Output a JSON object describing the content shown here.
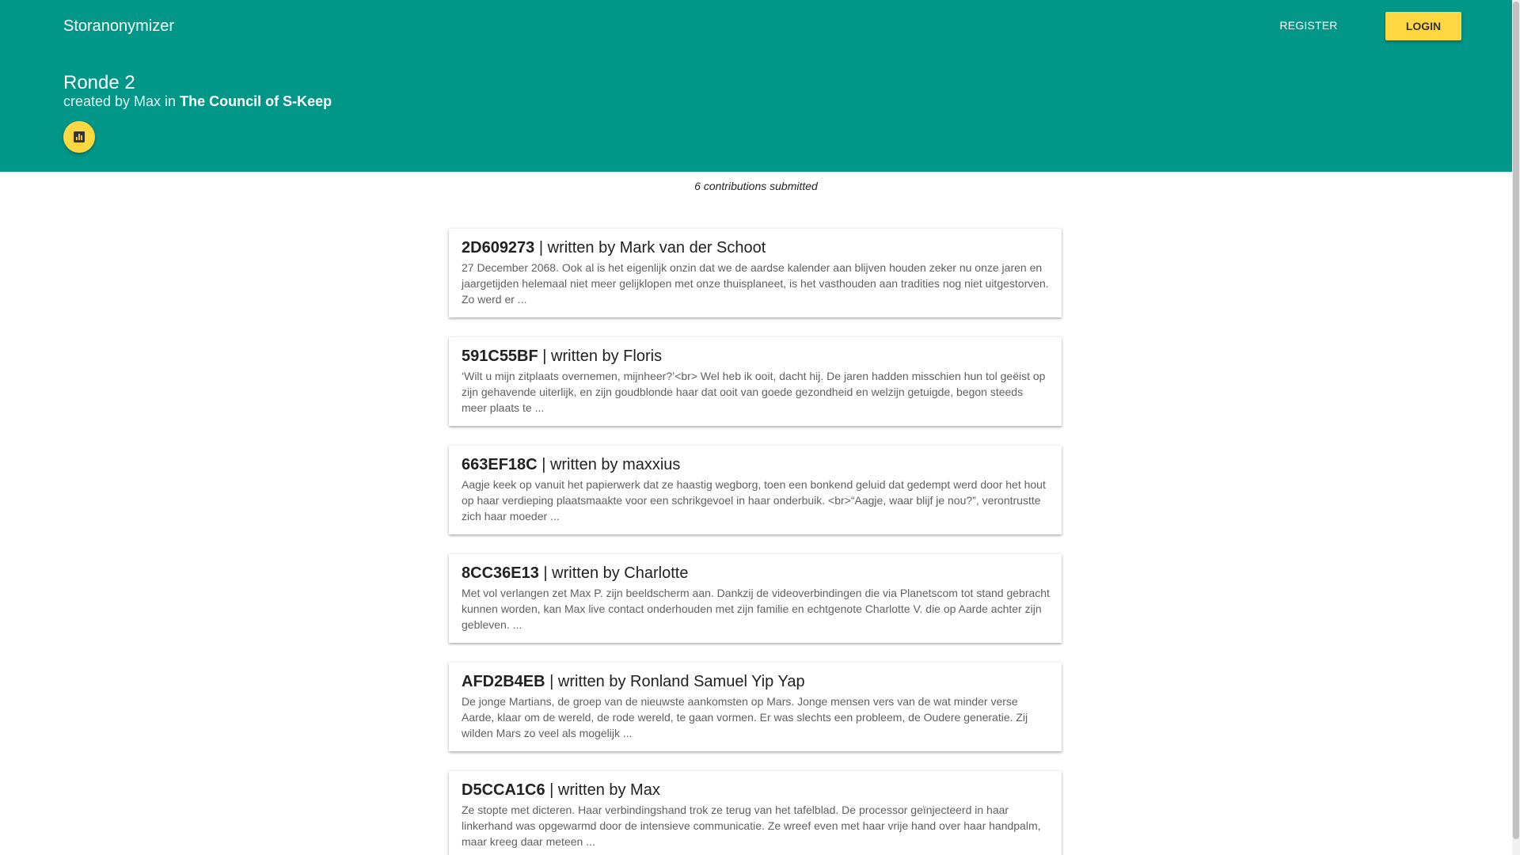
{
  "app": {
    "brand": "Storanonymizer",
    "register_label": "REGISTER",
    "login_label": "LOGIN"
  },
  "round": {
    "title": "Ronde 2",
    "created_prefix": "created by Max in",
    "group": "The Council of S-Keep",
    "stats_icon": "bar-chart-icon"
  },
  "contributions_count": "6 contributions submitted",
  "contributions": [
    {
      "id": "2D609273",
      "byline": "| written by Mark van der Schoot",
      "excerpt": "27 December 2068. Ook al is het eigenlijk onzin dat we de aardse kalender aan blijven houden zeker nu onze jaren en jaargetijden helemaal niet meer gelijklopen met onze thuisplaneet, is het vasthouden aan tradities nog niet uitgestorven. Zo werd er ..."
    },
    {
      "id": "591C55BF",
      "byline": "| written by Floris",
      "excerpt": "‘Wilt u mijn zitplaats overnemen, mijnheer?’<br> Wel heb ik ooit, dacht hij. De jaren hadden misschien hun tol geëist op zijn gehavende uiterlijk, en zijn goudblonde haar dat ooit van goede gezondheid en welzijn getuigde, begon steeds meer plaats te ..."
    },
    {
      "id": "663EF18C",
      "byline": "| written by maxxius",
      "excerpt": "Aagje keek op vanuit het papierwerk dat ze haastig wegborg, toen een bonkend geluid dat gedempt werd door het hout op haar verdieping plaatsmaakte voor een schrikgevoel in haar onderbuik. <br>“Aagje, waar blijf je nou?”, verontrustte zich haar moeder ..."
    },
    {
      "id": "8CC36E13",
      "byline": "| written by Charlotte",
      "excerpt": "Met vol verlangen zet Max P. zijn beeldscherm aan. Dankzij de videoverbindingen die via Planetscom tot stand gebracht kunnen worden, kan Max live contact onderhouden met zijn familie en echtgenote Charlotte V. die op Aarde achter zijn gebleven. ..."
    },
    {
      "id": "AFD2B4EB",
      "byline": "| written by Ronland Samuel Yip Yap",
      "excerpt": "De jonge Martians, de groep van de nieuwste aankomsten op Mars. Jonge mensen vers van de wat minder verse Aarde, klaar om de wereld, de rode wereld, te gaan vormen. Er was slechts een probleem, de Oudere generatie. Zij wilden Mars zo veel als mogelijk ..."
    },
    {
      "id": "D5CCA1C6",
      "byline": "| written by Max",
      "excerpt": "Ze stopte met dicteren. Haar verbindingshand trok ze terug van het tafelblad. De processor geïnjecteerd in haar linkerhand was opgewarmd door de intensieve communicatie. Ze wreef even met haar vrije hand over haar handpalm, maar kreeg daar meteen ..."
    }
  ],
  "colors": {
    "primary": "#009688",
    "accent": "#ffd740"
  }
}
